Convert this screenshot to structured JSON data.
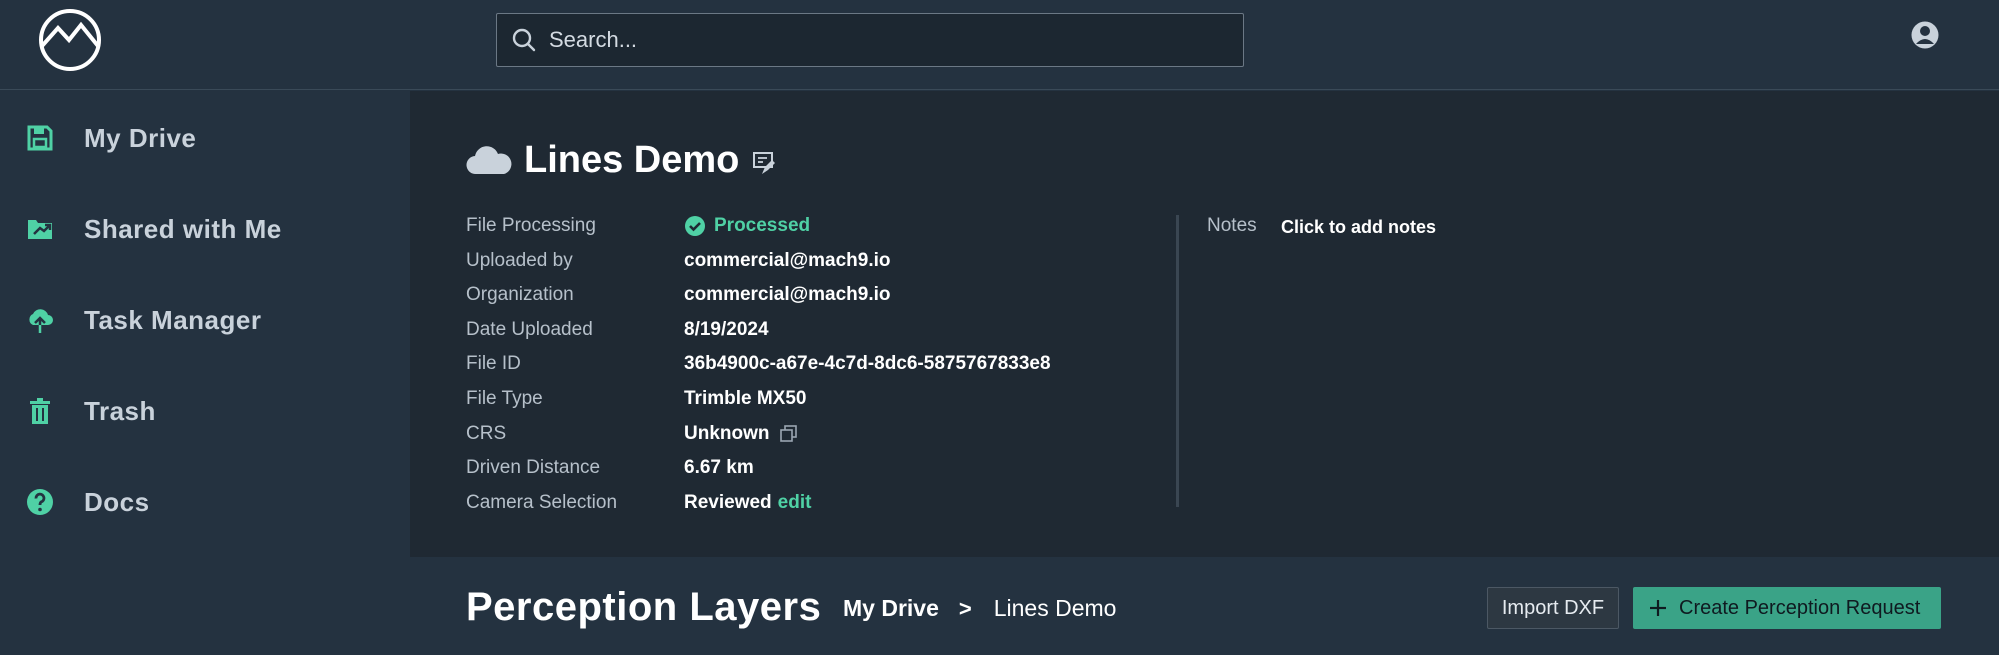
{
  "search": {
    "placeholder": "Search..."
  },
  "sidebar": {
    "items": [
      {
        "label": "My Drive",
        "icon": "save-disk-icon"
      },
      {
        "label": "Shared with Me",
        "icon": "shared-folder-icon"
      },
      {
        "label": "Task Manager",
        "icon": "cloud-upload-icon"
      },
      {
        "label": "Trash",
        "icon": "trash-icon"
      },
      {
        "label": "Docs",
        "icon": "help-circle-icon"
      }
    ]
  },
  "file": {
    "title": "Lines Demo",
    "properties": {
      "processing": {
        "label": "File Processing",
        "value": "Processed"
      },
      "uploaded_by": {
        "label": "Uploaded by",
        "value": "commercial@mach9.io"
      },
      "organization": {
        "label": "Organization",
        "value": "commercial@mach9.io"
      },
      "date_uploaded": {
        "label": "Date Uploaded",
        "value": "8/19/2024"
      },
      "file_id": {
        "label": "File ID",
        "value": "36b4900c-a67e-4c7d-8dc6-5875767833e8"
      },
      "file_type": {
        "label": "File Type",
        "value": "Trimble MX50"
      },
      "crs": {
        "label": "CRS",
        "value": "Unknown"
      },
      "driven_distance": {
        "label": "Driven Distance",
        "value": "6.67 km"
      },
      "camera_selection": {
        "label": "Camera Selection",
        "value": "Reviewed",
        "link": "edit"
      }
    },
    "notes": {
      "label": "Notes",
      "value": "Click to add notes"
    }
  },
  "perception": {
    "title": "Perception Layers",
    "breadcrumb": [
      "My Drive",
      "Lines Demo"
    ],
    "breadcrumb_separator": ">",
    "import_label": "Import DXF",
    "create_label": "Create Perception Request"
  },
  "colors": {
    "accent": "#4fd1a5",
    "button_primary": "#3aa387",
    "background": "#243240",
    "panel": "#1f2933"
  }
}
